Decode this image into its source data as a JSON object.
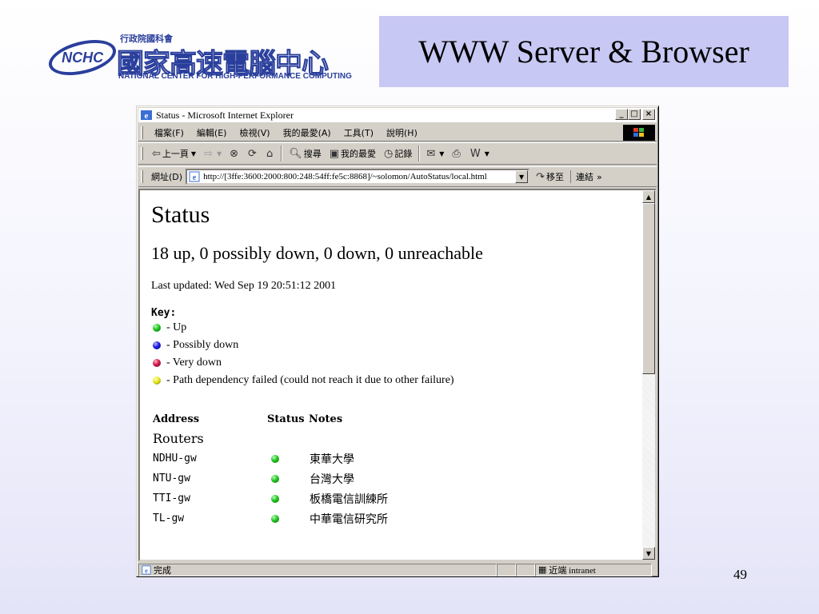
{
  "slide": {
    "title": "WWW Server & Browser",
    "page_number": "49",
    "logo": {
      "abbr": "NCHC",
      "small_cn": "行政院國科會",
      "main_cn": "國家高速電腦中心",
      "en": "NATIONAL CENTER FOR HIGH-PERFORMANCE COMPUTING"
    }
  },
  "browser": {
    "window_title": "Status - Microsoft Internet Explorer",
    "window_buttons": {
      "minimize": "_",
      "maximize": "□",
      "close": "×"
    },
    "menu": [
      "檔案(F)",
      "編輯(E)",
      "檢視(V)",
      "我的最愛(A)",
      "工具(T)",
      "說明(H)"
    ],
    "toolbar": {
      "back": "上一頁",
      "search": "搜尋",
      "favorites": "我的最愛",
      "history": "記錄"
    },
    "address": {
      "label": "網址(D)",
      "url": "http://[3ffe:3600:2000:800:248:54ff:fe5c:8868]/~solomon/AutoStatus/local.html",
      "go": "移至",
      "links": "連結",
      "links_more": "»"
    },
    "status_bar": {
      "text": "完成",
      "zone": "近端 intranet"
    }
  },
  "page": {
    "heading": "Status",
    "summary": "18 up, 0 possibly down, 0 down, 0 unreachable",
    "last_updated": "Last updated: Wed Sep 19 20:51:12 2001",
    "key_label": "Key:",
    "key_items": [
      {
        "color": "green",
        "label": "- Up"
      },
      {
        "color": "blue",
        "label": "- Possibly down"
      },
      {
        "color": "red",
        "label": "- Very down"
      },
      {
        "color": "yellow",
        "label": "- Path dependency failed (could not reach it due to other failure)"
      }
    ],
    "table": {
      "headers": {
        "address": "Address",
        "status": "Status",
        "notes": "Notes"
      },
      "section": "Routers",
      "rows": [
        {
          "address": "NDHU-gw",
          "status": "green",
          "note": "東華大學"
        },
        {
          "address": "NTU-gw",
          "status": "green",
          "note": "台灣大學"
        },
        {
          "address": "TTI-gw",
          "status": "green",
          "note": "板橋電信訓練所"
        },
        {
          "address": "TL-gw",
          "status": "green",
          "note": "中華電信研究所"
        }
      ]
    }
  },
  "colors": {
    "title_box": "#c8c8f4",
    "logo_blue": "#2a3f9c",
    "window_chrome": "#d4d0c8"
  }
}
